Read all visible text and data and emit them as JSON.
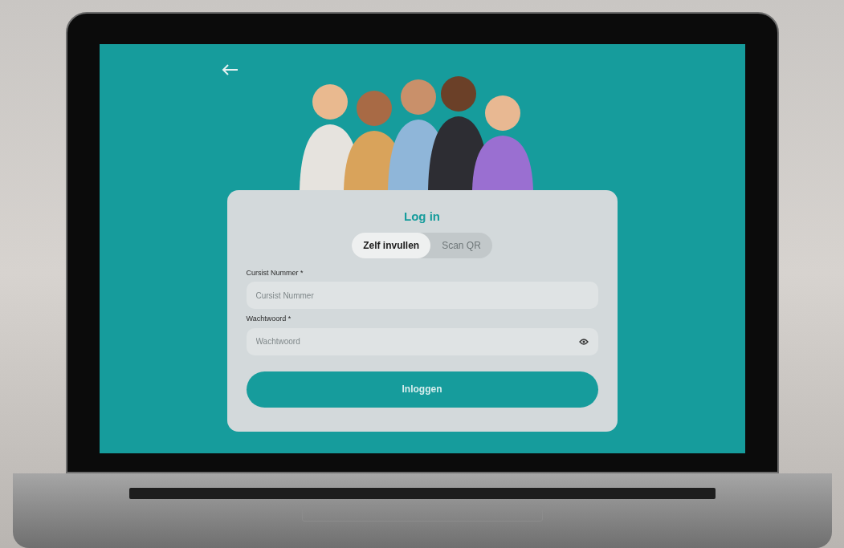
{
  "title": "Log in",
  "tabs": [
    {
      "label": "Zelf invullen",
      "selected": true
    },
    {
      "label": "Scan QR",
      "selected": false
    }
  ],
  "fields": [
    {
      "label": "Cursist Nummer *",
      "placeholder": "Cursist Nummer",
      "kind": "text"
    },
    {
      "label": "Wachtwoord *",
      "placeholder": "Wachtwoord",
      "kind": "password"
    }
  ],
  "submit": "Inloggen"
}
